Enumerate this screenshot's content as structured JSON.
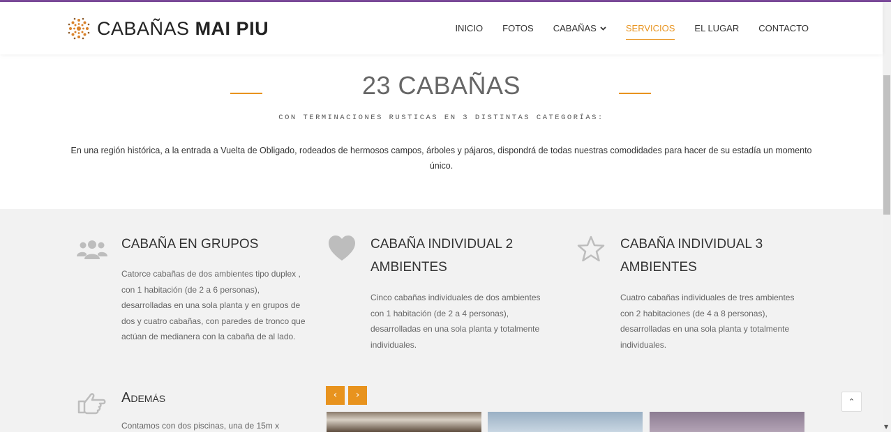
{
  "brand": {
    "light": "CABAÑAS",
    "bold": "MAI PIU"
  },
  "nav": [
    {
      "label": "INICIO"
    },
    {
      "label": "FOTOS"
    },
    {
      "label": "CABAÑAS",
      "dropdown": true
    },
    {
      "label": "SERVICIOS",
      "active": true
    },
    {
      "label": "EL LUGAR"
    },
    {
      "label": "CONTACTO"
    }
  ],
  "intro": {
    "title": "23 CABAÑAS",
    "subtitle": "CON TERMINACIONES RUSTICAS EN 3 DISTINTAS CATEGORÍAS:",
    "description": "En una región histórica, a la entrada a Vuelta de Obligado, rodeados de hermosos campos, árboles y pájaros, dispondrá de todas nuestras comodidades para hacer de su estadía un momento único."
  },
  "features": [
    {
      "icon": "users-icon",
      "title": "CABAÑA EN GRUPOS",
      "text": "Catorce cabañas de dos ambientes tipo duplex , con 1 habitación (de 2 a 6 personas), desarrolladas en una sola planta y en grupos de dos y cuatro cabañas, con paredes de tronco que actúan de medianera con la cabaña de al lado."
    },
    {
      "icon": "heart-icon",
      "title": "CABAÑA INDIVIDUAL 2 AMBIENTES",
      "text": "Cinco cabañas individuales de dos ambientes con 1 habitación (de 2 a 4 personas), desarrolladas en una sola planta y totalmente individuales."
    },
    {
      "icon": "star-icon",
      "title": "CABAÑA INDIVIDUAL 3 AMBIENTES",
      "text": "Cuatro cabañas individuales de tres ambientes con 2 habitaciones (de 4 a 8 personas), desarrolladas en una sola planta y totalmente individuales."
    },
    {
      "icon": "hand-pointing-icon",
      "title": "Además",
      "text": "Contamos con dos piscinas, una de 15m x"
    }
  ],
  "slider": {
    "prev": "‹",
    "next": "›"
  },
  "totop": "⌃",
  "colors": {
    "accent": "#e8931e",
    "topbar": "#7b4a9a"
  }
}
